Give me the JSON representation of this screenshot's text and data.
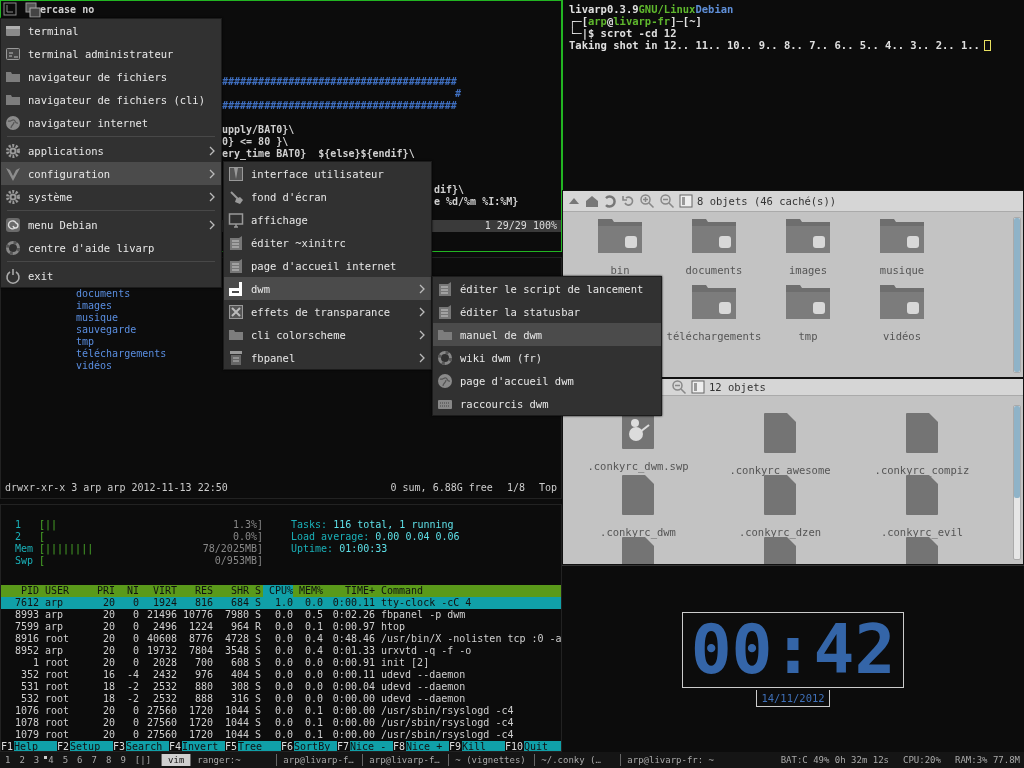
{
  "vim": {
    "lines": [
      {
        "text": "ercase no",
        "color": "#d0d0d0"
      },
      {
        "text": "#######################################",
        "color": "#3f6fc0"
      },
      {
        "text": "#",
        "color": "#3f6fc0"
      },
      {
        "text": "#######################################",
        "color": "#3f6fc0"
      },
      {
        "text": "upply/BAT0}\\",
        "color": "#d0d0d0"
      },
      {
        "text": "0} <= 80 }\\",
        "color": "#d0d0d0"
      },
      {
        "text": "ery_time BAT0}  ${else}${endif}\\",
        "color": "#d0d0d0"
      },
      {
        "text": "dif}\\",
        "color": "#d0d0d0"
      },
      {
        "text": "e %d/%m %I:%M}",
        "color": "#d0d0d0"
      }
    ],
    "status": "1 29/29 100%"
  },
  "ranger": {
    "files": [
      "documents",
      "images",
      "musique",
      "sauvegarde",
      "tmp",
      "téléchargements",
      "vidéos"
    ],
    "info": "drwxr-xr-x 3 arp arp 2012-11-13 22:50",
    "summary": [
      "0 sum, 6.88G free",
      "1/8",
      "Top"
    ]
  },
  "htop": {
    "meters": [
      {
        "label": "1",
        "bar": "[||",
        "value": "1.3%]"
      },
      {
        "label": "2",
        "bar": "[",
        "value": "0.0%]"
      },
      {
        "label": "Mem",
        "bar": "[||||||||",
        "value": "78/2025MB]"
      },
      {
        "label": "Swp",
        "bar": "[",
        "value": "0/953MB]"
      }
    ],
    "summary": [
      {
        "label": "Tasks:",
        "value": "116 total, 1 running"
      },
      {
        "label": "Load average:",
        "value": "0.00 0.04 0.06"
      },
      {
        "label": "Uptime:",
        "value": "01:00:33"
      }
    ],
    "columns": [
      {
        "label": "PID",
        "sorted": false
      },
      {
        "label": "USER",
        "sorted": false
      },
      {
        "label": "PRI",
        "sorted": false
      },
      {
        "label": "NI",
        "sorted": false
      },
      {
        "label": "VIRT",
        "sorted": false
      },
      {
        "label": "RES",
        "sorted": false
      },
      {
        "label": "SHR",
        "sorted": false
      },
      {
        "label": "S",
        "sorted": false
      },
      {
        "label": "CPU%",
        "sorted": true
      },
      {
        "label": "MEM%",
        "sorted": false
      },
      {
        "label": "TIME+",
        "sorted": false
      },
      {
        "label": "Command",
        "sorted": false
      }
    ],
    "rows": [
      {
        "selected": true,
        "cells": [
          "7612",
          "arp",
          "20",
          "0",
          "1924",
          "816",
          "684",
          "S",
          "1.0",
          "0.0",
          "0:00.11",
          "tty-clock -cC 4"
        ]
      },
      {
        "selected": false,
        "cells": [
          "8993",
          "arp",
          "20",
          "0",
          "21496",
          "10776",
          "7980",
          "S",
          "0.0",
          "0.5",
          "0:02.26",
          "fbpanel -p dwm"
        ]
      },
      {
        "selected": false,
        "cells": [
          "7599",
          "arp",
          "20",
          "0",
          "2496",
          "1224",
          "964",
          "R",
          "0.0",
          "0.1",
          "0:00.97",
          "htop"
        ]
      },
      {
        "selected": false,
        "cells": [
          "8916",
          "root",
          "20",
          "0",
          "40608",
          "8776",
          "4728",
          "S",
          "0.0",
          "0.4",
          "0:48.46",
          "/usr/bin/X -nolisten tcp :0 -a"
        ]
      },
      {
        "selected": false,
        "cells": [
          "8952",
          "arp",
          "20",
          "0",
          "19732",
          "7804",
          "3548",
          "S",
          "0.0",
          "0.4",
          "0:01.33",
          "urxvtd -q -f -o"
        ]
      },
      {
        "selected": false,
        "cells": [
          "1",
          "root",
          "20",
          "0",
          "2028",
          "700",
          "608",
          "S",
          "0.0",
          "0.0",
          "0:00.91",
          "init [2]"
        ]
      },
      {
        "selected": false,
        "cells": [
          "352",
          "root",
          "16",
          "-4",
          "2432",
          "976",
          "404",
          "S",
          "0.0",
          "0.0",
          "0:00.11",
          "udevd --daemon"
        ]
      },
      {
        "selected": false,
        "cells": [
          "531",
          "root",
          "18",
          "-2",
          "2532",
          "880",
          "308",
          "S",
          "0.0",
          "0.0",
          "0:00.04",
          "udevd --daemon"
        ]
      },
      {
        "selected": false,
        "cells": [
          "532",
          "root",
          "18",
          "-2",
          "2532",
          "888",
          "316",
          "S",
          "0.0",
          "0.0",
          "0:00.00",
          "udevd --daemon"
        ]
      },
      {
        "selected": false,
        "cells": [
          "1076",
          "root",
          "20",
          "0",
          "27560",
          "1720",
          "1044",
          "S",
          "0.0",
          "0.1",
          "0:00.00",
          "/usr/sbin/rsyslogd -c4"
        ]
      },
      {
        "selected": false,
        "cells": [
          "1078",
          "root",
          "20",
          "0",
          "27560",
          "1720",
          "1044",
          "S",
          "0.0",
          "0.1",
          "0:00.00",
          "/usr/sbin/rsyslogd -c4"
        ]
      },
      {
        "selected": false,
        "cells": [
          "1079",
          "root",
          "20",
          "0",
          "27560",
          "1720",
          "1044",
          "S",
          "0.0",
          "0.1",
          "0:00.00",
          "/usr/sbin/rsyslogd -c4"
        ]
      }
    ],
    "function_keys": [
      {
        "key": "F1",
        "label": "Help"
      },
      {
        "key": "F2",
        "label": "Setup"
      },
      {
        "key": "F3",
        "label": "Search"
      },
      {
        "key": "F4",
        "label": "Invert"
      },
      {
        "key": "F5",
        "label": "Tree"
      },
      {
        "key": "F6",
        "label": "SortBy"
      },
      {
        "key": "F7",
        "label": "Nice -"
      },
      {
        "key": "F8",
        "label": "Nice +"
      },
      {
        "key": "F9",
        "label": "Kill"
      },
      {
        "key": "F10",
        "label": "Quit"
      }
    ]
  },
  "terminal": {
    "lines": [
      {
        "segments": [
          {
            "text": "livarp0.3.9",
            "color": "#e0e0e0"
          },
          {
            "text": "GNU/Linux",
            "color": "#5fb82d"
          },
          {
            "text": "Debian",
            "color": "#5f8fd8"
          }
        ]
      },
      {
        "segments": [
          {
            "text": "┌─[",
            "color": "#e0e0e0"
          },
          {
            "text": "arp",
            "color": "#5fb82d"
          },
          {
            "text": "@",
            "color": "#e0e0e0"
          },
          {
            "text": "livarp-fr",
            "color": "#5fb82d"
          },
          {
            "text": "]─[~]",
            "color": "#e0e0e0"
          }
        ]
      },
      {
        "segments": [
          {
            "text": "└─|$ scrot -cd 12",
            "color": "#e0e0e0"
          }
        ]
      },
      {
        "segments": [
          {
            "text": "Taking shot in 12.. 11.. 10.. 9.. 8.. 7.. 6.. 5.. 4.. 3.. 2.. 1..",
            "color": "#e0e0e0"
          }
        ]
      }
    ]
  },
  "file_manager_top": {
    "status": "8 objets (46 caché(s))",
    "items": [
      "bin",
      "documents",
      "images",
      "musique",
      "téléchargements",
      "tmp",
      "vidéos"
    ]
  },
  "file_manager_bottom": {
    "status": "12 objets",
    "items": [
      ".conkyrc_dwm.swp",
      ".conkyrc_awesome",
      ".conkyrc_compiz",
      ".conkyrc_dwm",
      ".conkyrc_dzen",
      ".conkyrc_evil"
    ]
  },
  "clock": {
    "time": "00:42",
    "date": "14/11/2012"
  },
  "main_menu": {
    "sections": [
      {
        "items": [
          {
            "label": "terminal",
            "submenu": false,
            "selected": false
          },
          {
            "label": "terminal administrateur",
            "submenu": false,
            "selected": false
          },
          {
            "label": "navigateur de fichiers",
            "submenu": false,
            "selected": false
          },
          {
            "label": "navigateur de fichiers (cli)",
            "submenu": false,
            "selected": false
          },
          {
            "label": "navigateur internet",
            "submenu": false,
            "selected": false
          }
        ]
      },
      {
        "items": [
          {
            "label": "applications",
            "submenu": true,
            "selected": false
          },
          {
            "label": "configuration",
            "submenu": true,
            "selected": true
          },
          {
            "label": "système",
            "submenu": true,
            "selected": false
          }
        ]
      },
      {
        "items": [
          {
            "label": "menu Debian",
            "submenu": true,
            "selected": false
          },
          {
            "label": "centre d'aide livarp",
            "submenu": false,
            "selected": false
          }
        ]
      },
      {
        "items": [
          {
            "label": "exit",
            "submenu": false,
            "selected": false
          }
        ]
      }
    ]
  },
  "config_menu": {
    "items": [
      {
        "label": "interface utilisateur",
        "submenu": false,
        "selected": false
      },
      {
        "label": "fond d'écran",
        "submenu": false,
        "selected": false
      },
      {
        "label": "affichage",
        "submenu": false,
        "selected": false
      },
      {
        "label": "éditer ~xinitrc",
        "submenu": false,
        "selected": false
      },
      {
        "label": "page d'accueil internet",
        "submenu": false,
        "selected": false
      },
      {
        "label": "dwm",
        "submenu": true,
        "selected": true
      },
      {
        "label": "effets de transparance",
        "submenu": true,
        "selected": false
      },
      {
        "label": "cli colorscheme",
        "submenu": true,
        "selected": false
      },
      {
        "label": "fbpanel",
        "submenu": true,
        "selected": false
      }
    ]
  },
  "dwm_menu": {
    "items": [
      {
        "label": "éditer le script de lancement",
        "submenu": false,
        "selected": false
      },
      {
        "label": "éditer la statusbar",
        "submenu": false,
        "selected": false
      },
      {
        "label": "manuel de dwm",
        "submenu": false,
        "selected": true
      },
      {
        "label": "wiki dwm (fr)",
        "submenu": false,
        "selected": false
      },
      {
        "label": "page d'accueil dwm",
        "submenu": false,
        "selected": false
      },
      {
        "label": "raccourcis dwm",
        "submenu": false,
        "selected": false
      }
    ]
  },
  "bar": {
    "tags": [
      {
        "label": "1",
        "occupied": false
      },
      {
        "label": "2",
        "occupied": false
      },
      {
        "label": "3",
        "occupied": false
      },
      {
        "label": "4",
        "occupied": true
      },
      {
        "label": "5",
        "occupied": false
      },
      {
        "label": "6",
        "occupied": false
      },
      {
        "label": "7",
        "occupied": false
      },
      {
        "label": "8",
        "occupied": false
      },
      {
        "label": "9",
        "occupied": false
      }
    ],
    "layout": "[|]",
    "windows": [
      {
        "title": "vim",
        "selected": true
      },
      {
        "title": "ranger:~",
        "selected": false
      },
      {
        "title": "arp@livarp-f…",
        "selected": false
      },
      {
        "title": "arp@livarp-f…",
        "selected": false
      },
      {
        "title": "~ (vignettes)",
        "selected": false
      },
      {
        "title": "~/.conky (…",
        "selected": false
      },
      {
        "title": "arp@livarp-fr: ~",
        "selected": false
      }
    ],
    "status": [
      "BAT:C 49% 0h 32m 12s",
      "CPU:20%",
      "RAM:3% 77.8M"
    ]
  }
}
